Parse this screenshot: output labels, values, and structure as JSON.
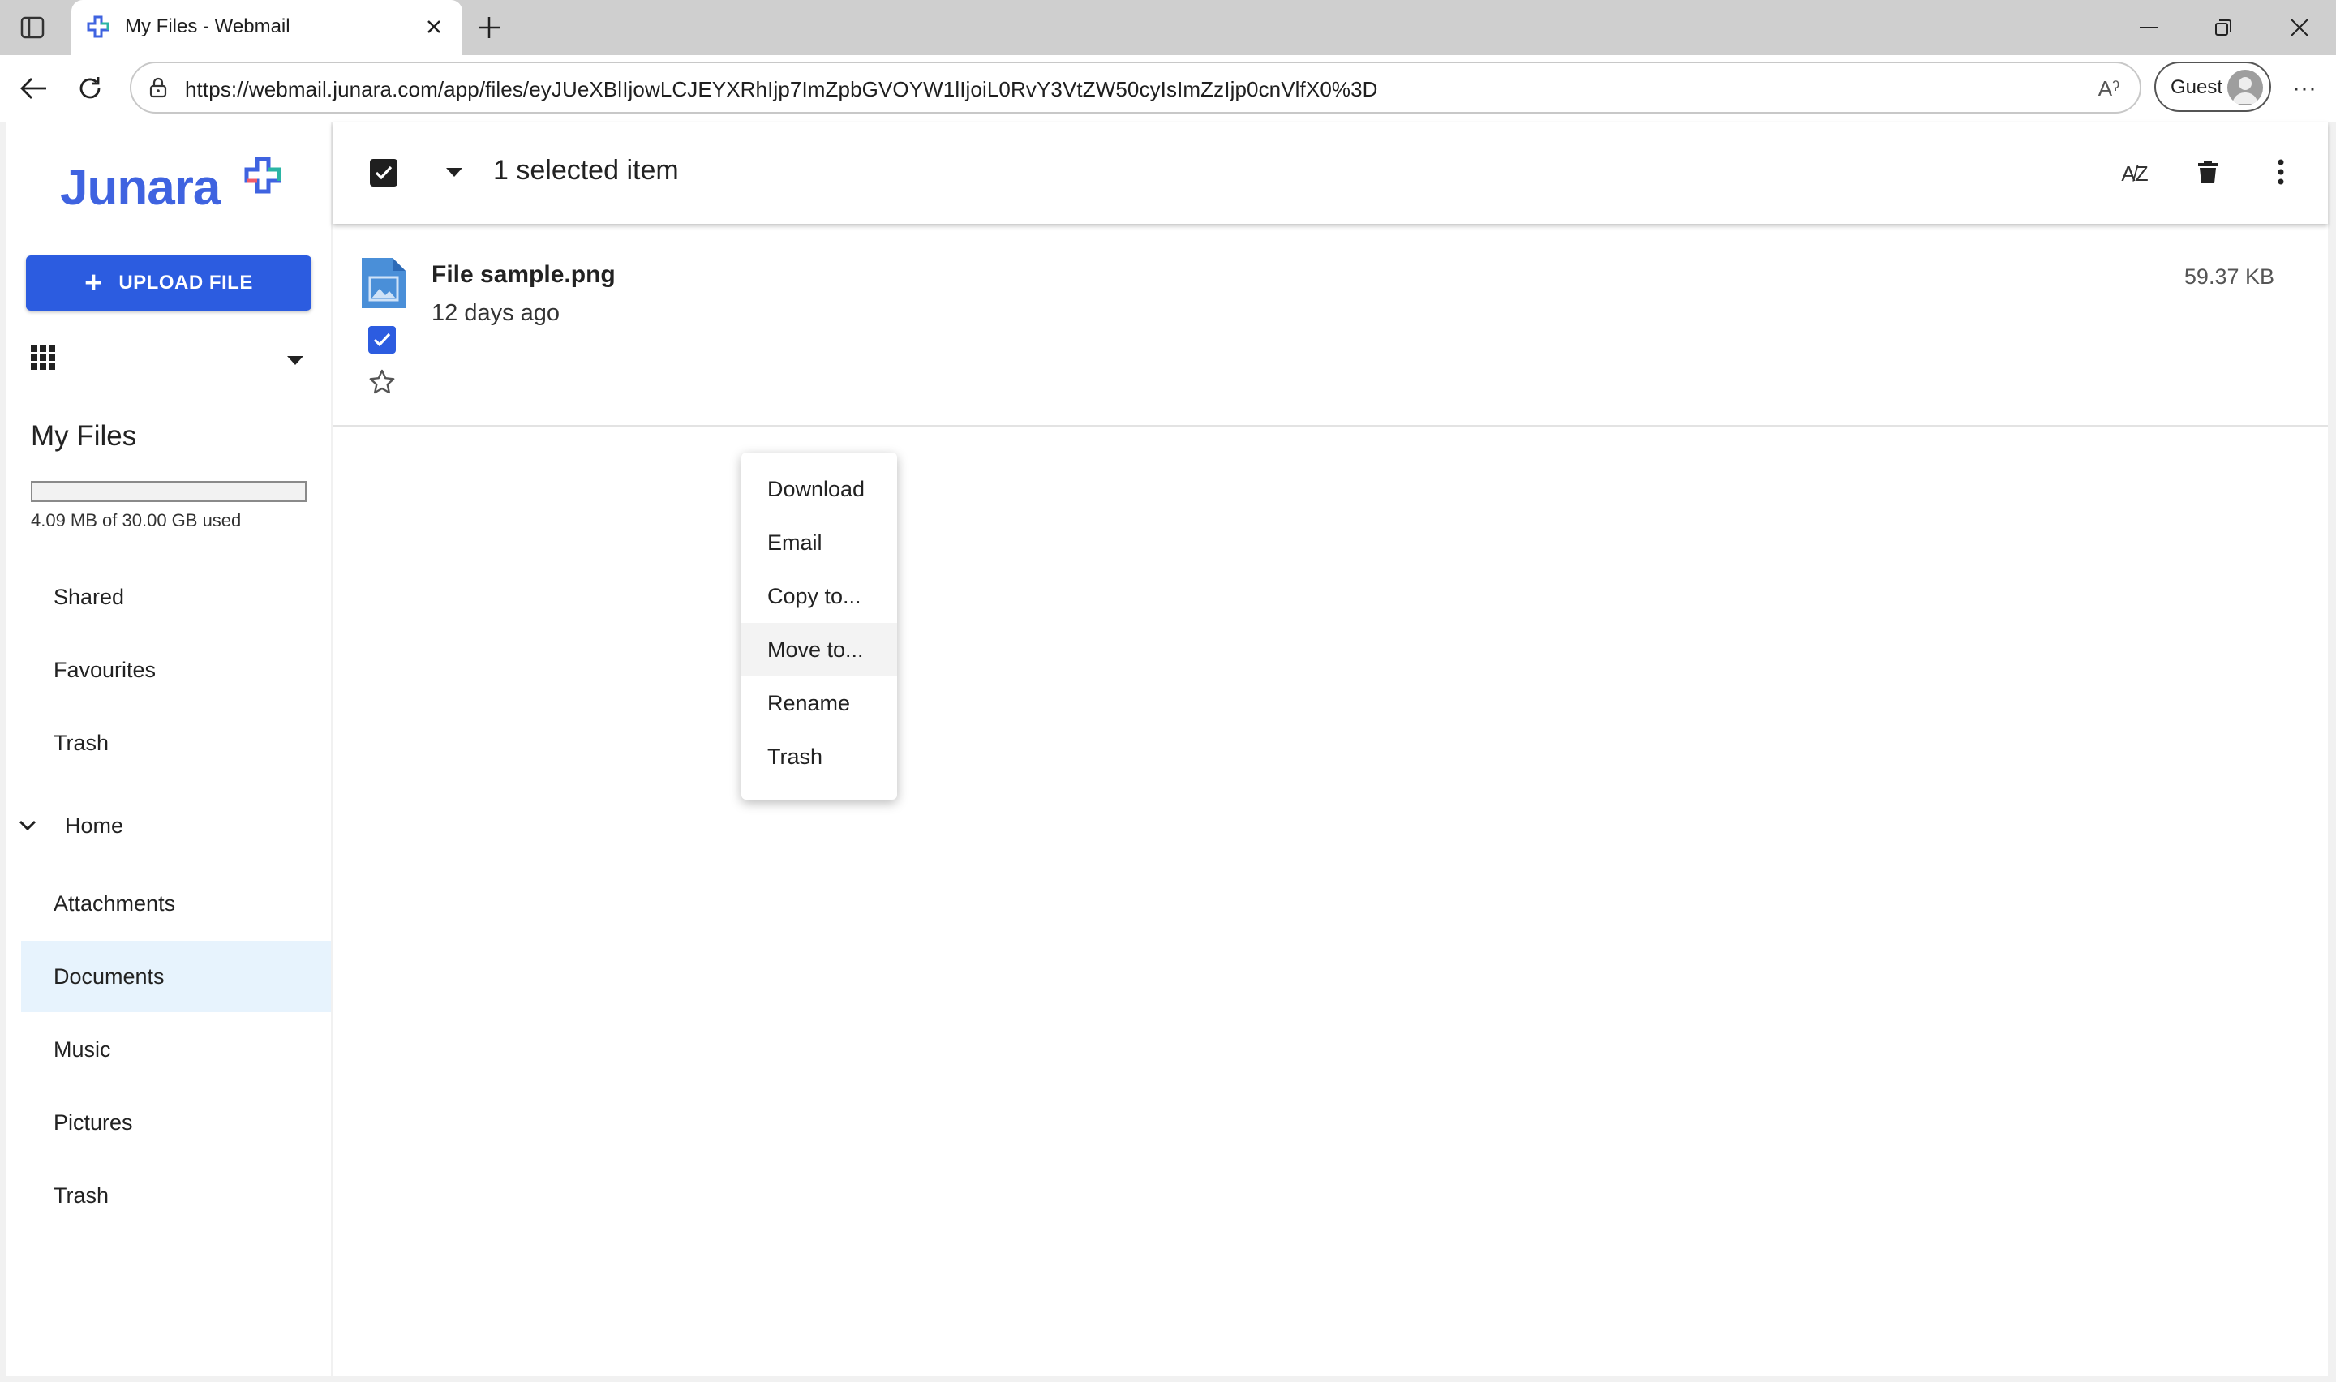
{
  "browser": {
    "tab_title": "My Files - Webmail",
    "url": "https://webmail.junara.com/app/files/eyJUeXBlIjowLCJEYXRhIjp7ImZpbGVOYW1lIjoiL0RvY3VtZW50cyIsImZzIjp0cnVlfX0%3D",
    "profile_label": "Guest",
    "more_glyph": "···",
    "read_aloud_glyph": "Aˀ"
  },
  "app": {
    "logo_text": "Junara",
    "accent_color": "#2c5ce0",
    "upload_plus": "+",
    "upload_label": "UPLOAD FILE"
  },
  "sidebar": {
    "title": "My Files",
    "quota_text": "4.09 MB of 30.00 GB used",
    "quota_fraction": 0.0001,
    "items_top": [
      "Shared",
      "Favourites",
      "Trash"
    ],
    "home_label": "Home",
    "items_home": [
      "Attachments",
      "Documents",
      "Music",
      "Pictures",
      "Trash"
    ],
    "active_item": "Documents"
  },
  "header": {
    "selection_text": "1 selected item",
    "sort_glyph": "A̸Z"
  },
  "files": [
    {
      "name": "File sample.png",
      "modified": "12 days ago",
      "size": "59.37 KB",
      "selected": true,
      "starred": false
    }
  ],
  "context_menu": {
    "items": [
      "Download",
      "Email",
      "Copy to...",
      "Move to...",
      "Rename",
      "Trash"
    ],
    "hovered": "Move to..."
  }
}
